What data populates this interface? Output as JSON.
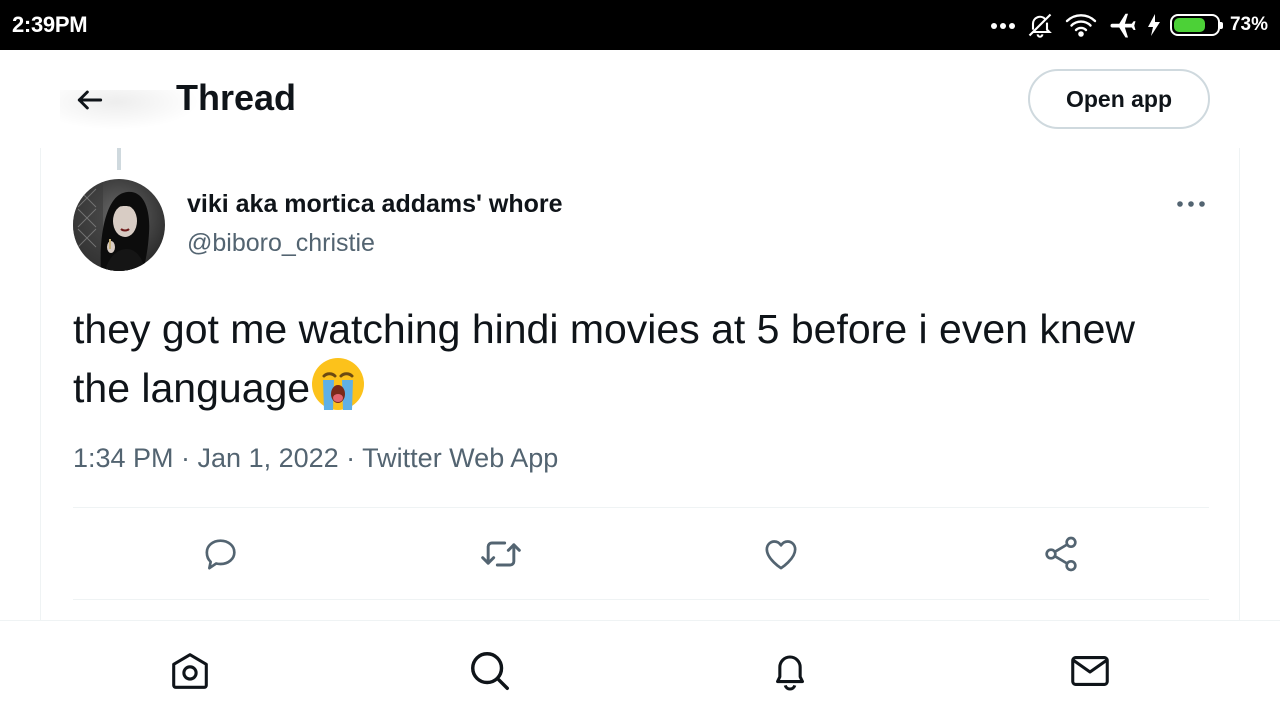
{
  "status_bar": {
    "time": "2:39PM",
    "battery_percent": "73%",
    "battery_level": 0.73,
    "battery_color": "#4cd137",
    "icons": [
      "more-dots-icon",
      "bell-off-icon",
      "wifi-icon",
      "airplane-icon",
      "charging-icon",
      "battery-icon"
    ]
  },
  "header": {
    "back_icon": "arrow-left-icon",
    "title": "Thread",
    "open_app_label": "Open app"
  },
  "tweet": {
    "display_name": "viki aka mortica addams' whore",
    "handle": "@biboro_christie",
    "text": "they got me watching hindi movies at 5 before i even knew the language",
    "emoji": "loudly-crying-face",
    "meta": "1:34 PM · Jan 1, 2022 · Twitter Web App",
    "actions": [
      "reply-icon",
      "retweet-icon",
      "like-icon",
      "share-icon"
    ]
  },
  "bottom_nav": {
    "items": [
      "home-icon",
      "search-icon",
      "notifications-icon",
      "messages-icon"
    ]
  },
  "colors": {
    "text_primary": "#0f1419",
    "text_secondary": "#536471",
    "border": "#eff3f4"
  }
}
